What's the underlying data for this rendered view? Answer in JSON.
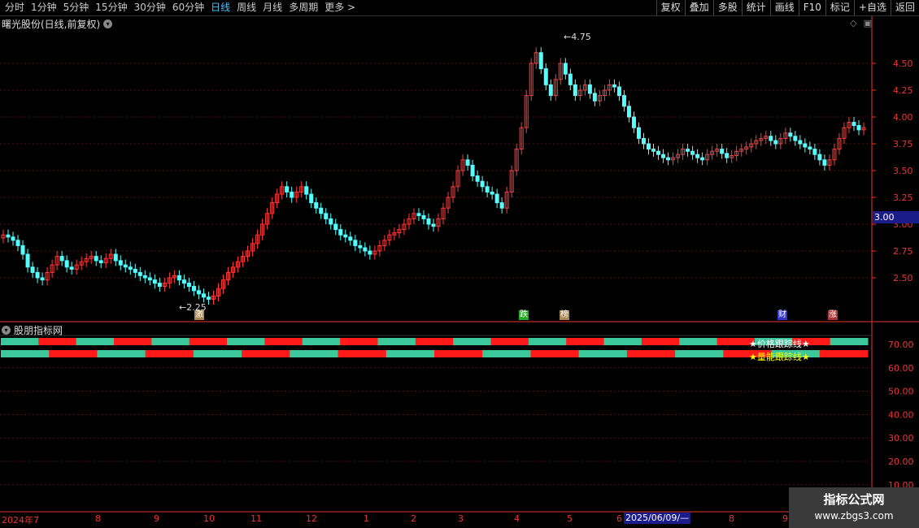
{
  "toolbar": {
    "periods": [
      "分时",
      "1分钟",
      "5分钟",
      "15分钟",
      "30分钟",
      "60分钟",
      "日线",
      "周线",
      "月线",
      "多周期",
      "更多 >"
    ],
    "active_period": "日线",
    "buttons": [
      "复权",
      "叠加",
      "多股",
      "统计",
      "画线",
      "F10",
      "标记",
      "+自选",
      "返回"
    ]
  },
  "chart_title": "曙光股份(日线,前复权)",
  "indicator_title": "股朋指标网",
  "current_price_tag": "3.00",
  "date_tag": "2025/06/09/—",
  "high_label": "4.75",
  "low_label": "2.25",
  "events": [
    {
      "label": "激",
      "color": "#c77"
    },
    {
      "label": "跌",
      "color": "#2a2"
    },
    {
      "label": "榜",
      "color": "#c77"
    },
    {
      "label": "财",
      "color": "#44f"
    },
    {
      "label": "涨",
      "color": "#c33"
    }
  ],
  "legend": {
    "line1": "★价格跟踪线★",
    "line2": "★量能跟踪线★"
  },
  "price_axis": [
    "4.50",
    "4.25",
    "4.00",
    "3.75",
    "3.50",
    "3.25",
    "3.00",
    "2.75",
    "2.50"
  ],
  "indicator_axis": [
    "70.00",
    "60.00",
    "50.00",
    "40.00",
    "30.00",
    "20.00",
    "10.00"
  ],
  "months": [
    "2024年7",
    "8",
    "9",
    "10",
    "11",
    "12",
    "1",
    "2",
    "3",
    "4",
    "5",
    "6",
    "8",
    "9"
  ],
  "watermark": {
    "title": "指标公式网",
    "url": "www.zbgs3.com"
  },
  "colors": {
    "up": "#ff3b3b",
    "down": "#54ffff",
    "band_green": "#3cc89b",
    "band_red": "#ff1a1a",
    "axis": "#e33"
  },
  "chart_data": {
    "type": "candlestick",
    "ylim": [
      2.25,
      4.75
    ],
    "closes": [
      2.9,
      2.88,
      2.85,
      2.8,
      2.72,
      2.6,
      2.55,
      2.5,
      2.48,
      2.55,
      2.62,
      2.7,
      2.66,
      2.6,
      2.58,
      2.62,
      2.65,
      2.68,
      2.7,
      2.66,
      2.64,
      2.68,
      2.72,
      2.66,
      2.62,
      2.6,
      2.58,
      2.55,
      2.52,
      2.5,
      2.48,
      2.45,
      2.42,
      2.45,
      2.5,
      2.52,
      2.48,
      2.45,
      2.42,
      2.38,
      2.35,
      2.32,
      2.3,
      2.33,
      2.4,
      2.48,
      2.55,
      2.6,
      2.65,
      2.7,
      2.75,
      2.82,
      2.9,
      3.0,
      3.1,
      3.2,
      3.28,
      3.35,
      3.3,
      3.25,
      3.3,
      3.35,
      3.28,
      3.2,
      3.15,
      3.1,
      3.05,
      3.0,
      2.95,
      2.9,
      2.88,
      2.85,
      2.8,
      2.78,
      2.75,
      2.72,
      2.75,
      2.8,
      2.85,
      2.9,
      2.92,
      2.95,
      3.0,
      3.05,
      3.1,
      3.08,
      3.05,
      3.0,
      2.98,
      3.05,
      3.15,
      3.25,
      3.35,
      3.5,
      3.6,
      3.55,
      3.45,
      3.4,
      3.35,
      3.3,
      3.28,
      3.2,
      3.15,
      3.3,
      3.5,
      3.7,
      3.9,
      4.2,
      4.5,
      4.6,
      4.45,
      4.3,
      4.2,
      4.35,
      4.5,
      4.4,
      4.3,
      4.2,
      4.25,
      4.3,
      4.22,
      4.15,
      4.2,
      4.25,
      4.3,
      4.28,
      4.2,
      4.1,
      4.0,
      3.9,
      3.8,
      3.75,
      3.7,
      3.68,
      3.65,
      3.62,
      3.6,
      3.62,
      3.65,
      3.7,
      3.68,
      3.65,
      3.62,
      3.6,
      3.65,
      3.68,
      3.7,
      3.66,
      3.62,
      3.64,
      3.68,
      3.7,
      3.72,
      3.75,
      3.78,
      3.8,
      3.82,
      3.78,
      3.75,
      3.8,
      3.85,
      3.82,
      3.78,
      3.75,
      3.72,
      3.7,
      3.65,
      3.6,
      3.55,
      3.6,
      3.7,
      3.8,
      3.9,
      3.95,
      3.92,
      3.88,
      3.9
    ]
  },
  "band_data": {
    "row1": [
      "g",
      "r",
      "g",
      "r",
      "g",
      "r",
      "g",
      "r",
      "g",
      "r",
      "g",
      "r",
      "g",
      "r",
      "g",
      "r",
      "g",
      "r",
      "g",
      "r",
      "g",
      "r",
      "g"
    ],
    "row2": [
      "g",
      "r",
      "g",
      "r",
      "g",
      "r",
      "g",
      "r",
      "g",
      "r",
      "g",
      "r",
      "g",
      "r",
      "g",
      "r",
      "g",
      "r"
    ]
  }
}
